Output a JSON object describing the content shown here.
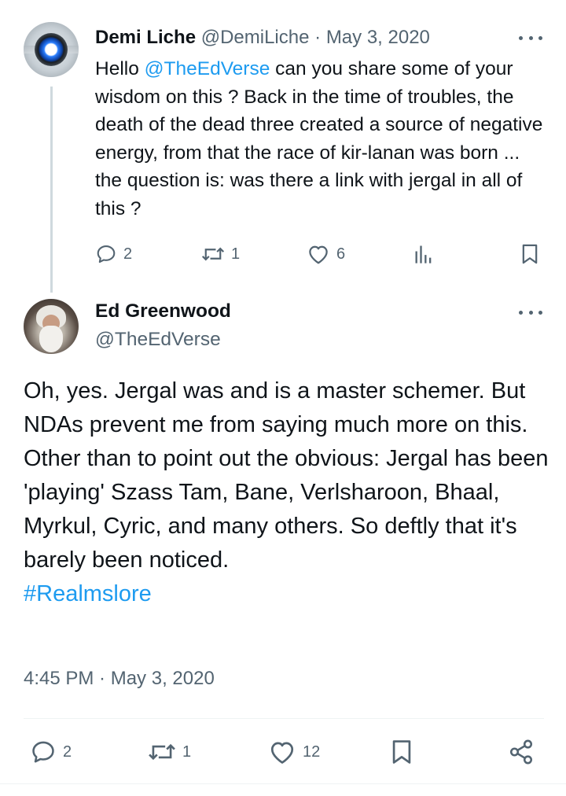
{
  "reply_to": {
    "display_name": "Demi Liche",
    "handle": "@DemiLiche",
    "separator": "·",
    "date": "May 3, 2020",
    "text_before_mention": "Hello ",
    "mention": "@TheEdVerse",
    "text_after_mention": " can you share some of your wisdom on this ? Back in the time of troubles, the death of the dead three created a source of negative energy, from that the race of kir-lanan was born ... the question is: was there a link with jergal in all of this ?",
    "actions": {
      "reply_icon": "reply-icon",
      "replies": "2",
      "retweet_icon": "retweet-icon",
      "retweets": "1",
      "like_icon": "heart-icon",
      "likes": "6",
      "views_icon": "views-chart-icon",
      "bookmark_icon": "bookmark-icon"
    }
  },
  "tweet": {
    "display_name": "Ed Greenwood",
    "handle": "@TheEdVerse",
    "paragraphs": [
      "Oh, yes. Jergal was and is a master schemer. But NDAs prevent me from saying much more on this.",
      "Other than to point out the obvious: Jergal has been 'playing' Szass Tam, Bane, Verlsharoon, Bhaal, Myrkul, Cyric, and many others. So deftly that it's barely been noticed."
    ],
    "hashtag": "#Realmslore",
    "timestamp": "4:45 PM · May 3, 2020",
    "actions": {
      "reply_icon": "reply-icon",
      "replies": "2",
      "retweet_icon": "retweet-icon",
      "retweets": "1",
      "like_icon": "heart-icon",
      "likes": "12",
      "bookmark_icon": "bookmark-icon",
      "share_icon": "share-icon"
    }
  },
  "colors": {
    "text": "#0f1419",
    "muted": "#536471",
    "link": "#1d9bf0",
    "divider": "#eff3f4"
  }
}
